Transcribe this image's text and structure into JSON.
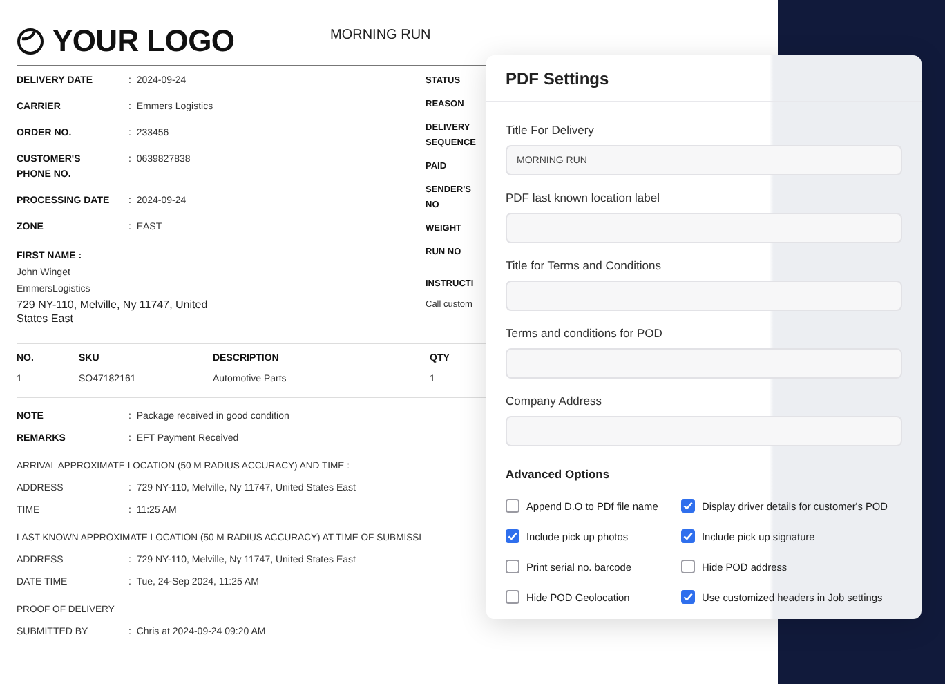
{
  "document": {
    "logo": "YOUR LOGO",
    "title": "MORNING RUN",
    "left_fields": [
      {
        "label": "DELIVERY DATE",
        "value": ":  2024-09-24"
      },
      {
        "label": "CARRIER",
        "value": ":  Emmers Logistics"
      },
      {
        "label": "ORDER NO.",
        "value": ":  233456"
      },
      {
        "label": "CUSTOMER'S PHONE NO.",
        "value": ":  0639827838"
      },
      {
        "label": "PROCESSING DATE",
        "value": ":  2024-09-24"
      },
      {
        "label": "ZONE",
        "value": ":  EAST"
      }
    ],
    "right_labels": [
      "STATUS",
      "REASON",
      "DELIVERY SEQUENCE",
      "PAID",
      "SENDER'S NO",
      "WEIGHT",
      "RUN NO"
    ],
    "instructions": {
      "label": "INSTRUCTI",
      "value": "Call custom"
    },
    "recipient": {
      "heading": "FIRST NAME :",
      "lines": [
        "John Winget",
        "EmmersLogistics",
        "729 NY-110, Melville, Ny 11747, United States East"
      ]
    },
    "table": {
      "columns": [
        "NO.",
        "SKU",
        "DESCRIPTION",
        "QTY"
      ],
      "rows": [
        [
          "1",
          "SO47182161",
          "Automotive Parts",
          "1"
        ]
      ]
    },
    "notes": [
      {
        "label": "NOTE",
        "value": ":  Package received in good condition"
      },
      {
        "label": "REMARKS",
        "value": ":  EFT Payment Received"
      }
    ],
    "sections": [
      {
        "heading": "ARRIVAL APPROXIMATE LOCATION (50 M RADIUS ACCURACY) AND TIME :",
        "fields": [
          {
            "label": "ADDRESS",
            "value": ":  729 NY-110, Melville, Ny 11747, United States East"
          },
          {
            "label": "TIME",
            "value": ":  11:25 AM"
          }
        ]
      },
      {
        "heading": "LAST KNOWN APPROXIMATE LOCATION (50 M RADIUS ACCURACY) AT TIME OF SUBMISSI",
        "fields": [
          {
            "label": "ADDRESS",
            "value": ":  729 NY-110, Melville, Ny 11747, United States East"
          },
          {
            "label": "DATE TIME",
            "value": ":  Tue, 24-Sep 2024, 11:25 AM"
          }
        ]
      },
      {
        "heading": "PROOF OF DELIVERY",
        "fields": [
          {
            "label": "SUBMITTED BY",
            "value": ":  Chris at 2024-09-24 09:20 AM"
          }
        ]
      }
    ]
  },
  "modal": {
    "title": "PDF Settings",
    "fields": [
      {
        "label": "Title For Delivery",
        "value": "MORNING RUN"
      },
      {
        "label": "PDF last known location label"
      },
      {
        "label": "Title for Terms and Conditions"
      },
      {
        "label": "Terms and conditions for POD"
      },
      {
        "label": "Company Address"
      }
    ],
    "advanced_heading": "Advanced Options",
    "options": [
      {
        "label": "Append D.O to PDf file name",
        "checked": false
      },
      {
        "label": "Display driver details for customer's POD",
        "checked": true
      },
      {
        "label": "Include pick up photos",
        "checked": true
      },
      {
        "label": "Include pick up signature",
        "checked": true
      },
      {
        "label": "Print serial no. barcode",
        "checked": false
      },
      {
        "label": "Hide POD address",
        "checked": false
      },
      {
        "label": "Hide POD Geolocation",
        "checked": false
      },
      {
        "label": "Use customized headers in Job settings",
        "checked": true
      }
    ]
  }
}
